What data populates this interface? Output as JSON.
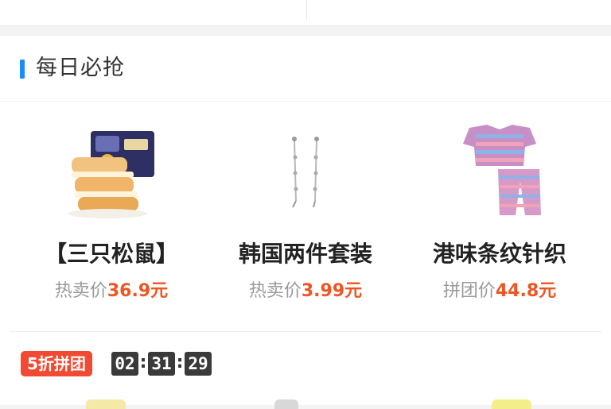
{
  "section": {
    "title": "每日必抢",
    "accent_color": "#1a8cff"
  },
  "products": [
    {
      "name": "【三只松鼠】",
      "price_label": "热卖价",
      "price_value": "36.9元",
      "image_icon": "bread-snack-icon"
    },
    {
      "name": "韩国两件套装",
      "price_label": "热卖价",
      "price_value": "3.99元",
      "image_icon": "earrings-icon"
    },
    {
      "name": "港味条纹针织",
      "price_label": "拼团价",
      "price_value": "44.8元",
      "image_icon": "striped-pajamas-icon"
    }
  ],
  "price_color": "#ee5522",
  "promo": {
    "badge": "5折拼团",
    "badge_color": "#f24a32",
    "timer": {
      "hours": "02",
      "minutes": "31",
      "seconds": "29",
      "separator": ":"
    }
  }
}
